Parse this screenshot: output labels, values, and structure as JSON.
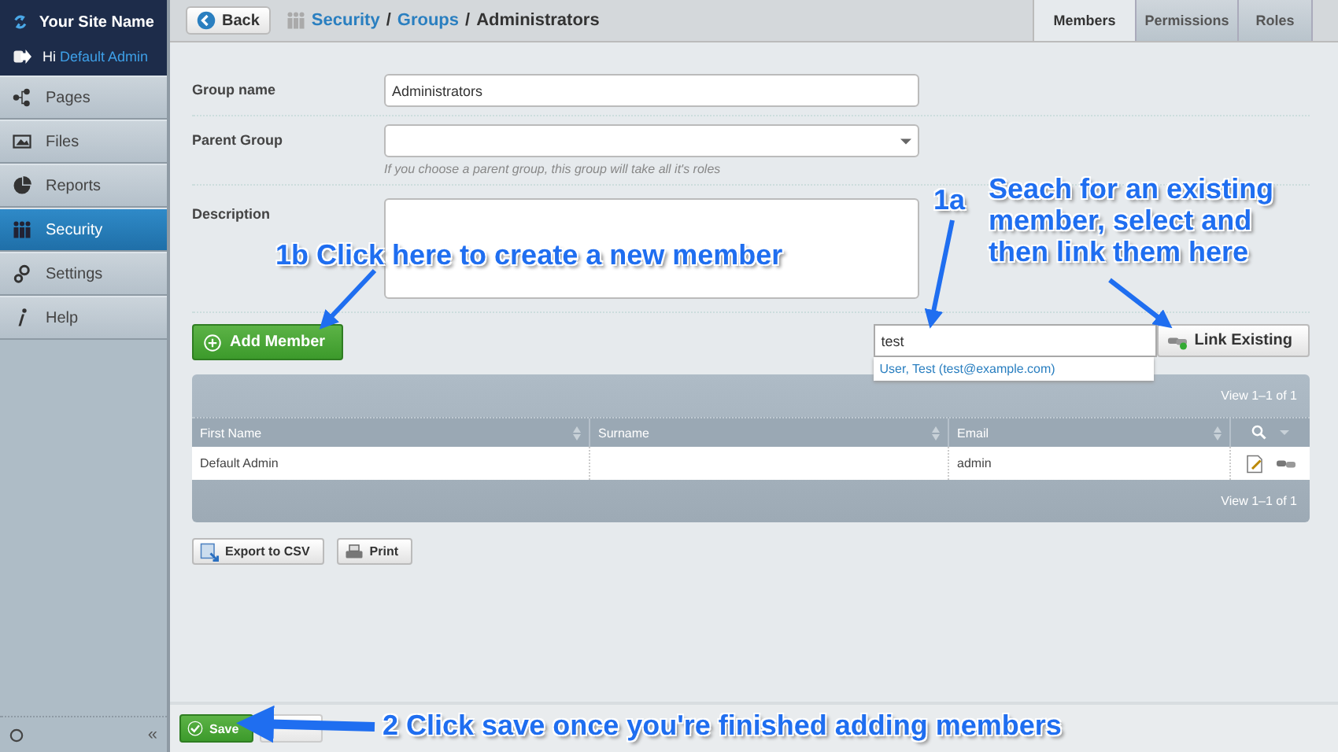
{
  "sidebar": {
    "site_name": "Your Site Name",
    "greeting": "Hi",
    "user": "Default Admin",
    "items": [
      {
        "label": "Pages",
        "selected": false
      },
      {
        "label": "Files",
        "selected": false
      },
      {
        "label": "Reports",
        "selected": false
      },
      {
        "label": "Security",
        "selected": true
      },
      {
        "label": "Settings",
        "selected": false
      },
      {
        "label": "Help",
        "selected": false
      }
    ],
    "collapse": "«"
  },
  "toolbar": {
    "back": "Back",
    "breadcrumb": [
      "Security",
      "Groups",
      "Administrators"
    ],
    "separator": "/"
  },
  "tabs": [
    {
      "label": "Members",
      "selected": true
    },
    {
      "label": "Permissions",
      "selected": false
    },
    {
      "label": "Roles",
      "selected": false
    }
  ],
  "form": [
    {
      "kind": "text",
      "label": "Group name",
      "value": "Administrators"
    },
    {
      "kind": "select",
      "label": "Parent Group",
      "hint": "If you choose a parent group, this group will take all it's roles"
    },
    {
      "kind": "textarea",
      "label": "Description"
    }
  ],
  "members": {
    "add_button": "Add Member",
    "search_value": "test",
    "suggestion": "User, Test (test@example.com)",
    "link_button": "Link Existing"
  },
  "table": {
    "pager_top": "View 1–1 of 1",
    "columns": [
      "First Name",
      "Surname",
      "Email"
    ],
    "rows": [
      [
        "Default Admin",
        "",
        "admin"
      ]
    ],
    "pager_bottom": "View 1–1 of 1"
  },
  "actions": [
    "Export to CSV",
    "Print"
  ],
  "footer": {
    "save": "Save"
  },
  "annotations": [
    {
      "lines": [
        "1b Click here to create a new member"
      ]
    },
    {
      "lines": [
        "1a"
      ]
    },
    {
      "lines": [
        "Seach for an existing",
        "member, select and",
        "then link them here"
      ]
    },
    {
      "lines": [
        "2 Click save once you're finished adding members"
      ]
    }
  ]
}
